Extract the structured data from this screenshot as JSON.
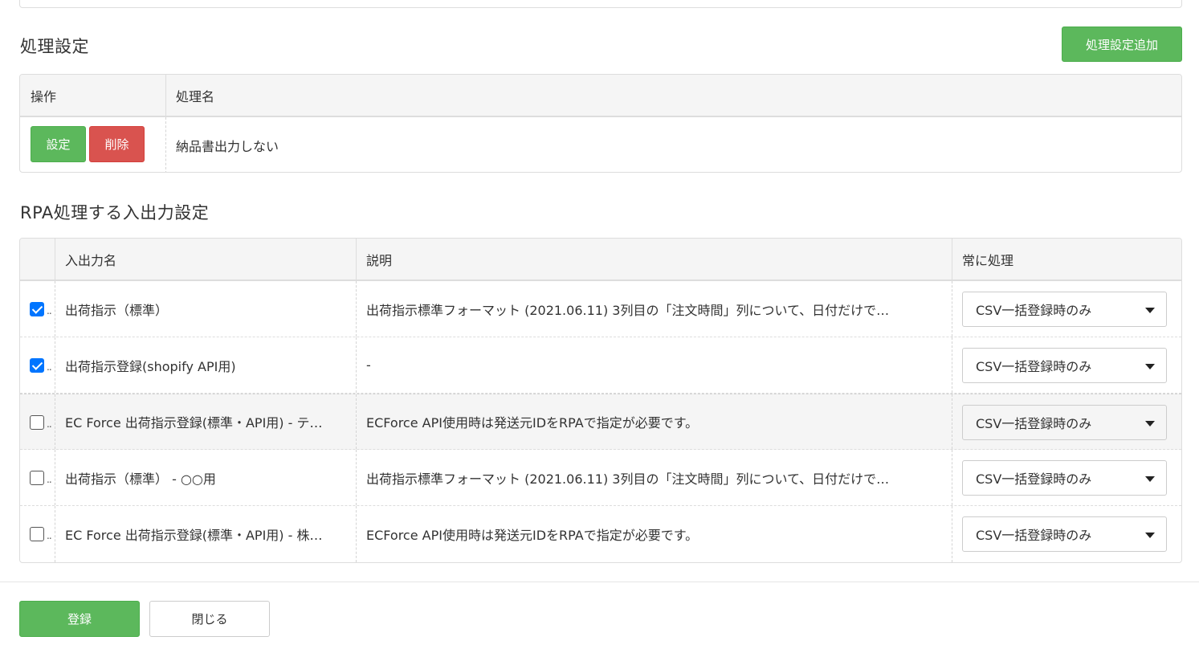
{
  "processing": {
    "title": "処理設定",
    "add_button": "処理設定追加",
    "columns": [
      "操作",
      "処理名"
    ],
    "row": {
      "edit_button": "設定",
      "delete_button": "削除",
      "name": "納品書出力しない"
    }
  },
  "rpa": {
    "title": "RPA処理する入出力設定",
    "columns": [
      "",
      "入出力名",
      "説明",
      "常に処理"
    ],
    "rows": [
      {
        "checked": true,
        "name": "出荷指示（標準）",
        "description": "出荷指示標準フォーマット (2021.06.11) 3列目の「注文時間」列について、日付だけで…",
        "option": "CSV一括登録時のみ"
      },
      {
        "checked": true,
        "name": "出荷指示登録(shopify API用)",
        "description": "-",
        "option": "CSV一括登録時のみ"
      },
      {
        "checked": false,
        "name": "EC Force 出荷指示登録(標準・API用) - テ…",
        "description": "ECForce API使用時は発送元IDをRPAで指定が必要です。",
        "option": "CSV一括登録時のみ"
      },
      {
        "checked": false,
        "name": "出荷指示（標準） - ○○用",
        "description": "出荷指示標準フォーマット (2021.06.11) 3列目の「注文時間」列について、日付だけで…",
        "option": "CSV一括登録時のみ"
      },
      {
        "checked": false,
        "name": "EC Force 出荷指示登録(標準・API用) - 株…",
        "description": "ECForce API使用時は発送元IDをRPAで指定が必要です。",
        "option": "CSV一括登録時のみ"
      }
    ]
  },
  "footer": {
    "register_button": "登録",
    "close_button": "閉じる"
  },
  "colors": {
    "green": "#5cb85c",
    "red": "#d9534f",
    "checkbox": "#0075ff",
    "header_bg": "#f5f5f5"
  }
}
